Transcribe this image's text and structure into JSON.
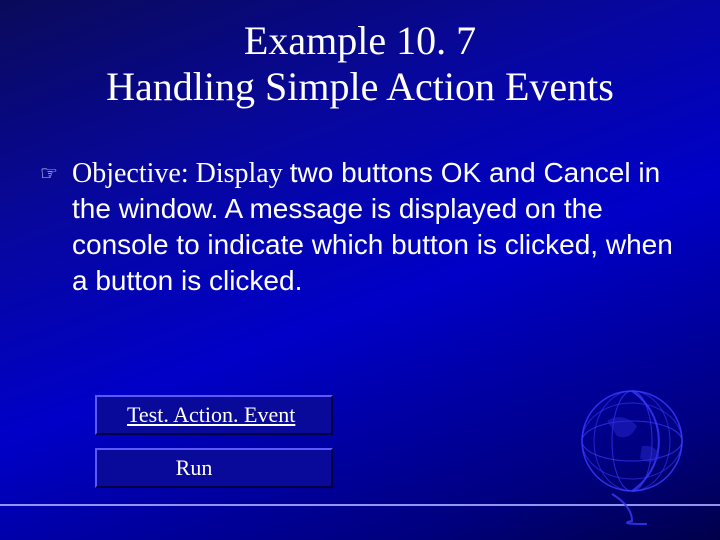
{
  "title_line1": "Example 10. 7",
  "title_line2": "Handling Simple Action Events",
  "bullet": {
    "label": "Objective: Display ",
    "body": "two buttons OK and Cancel in the window. A message is displayed on the console to indicate which button is clicked, when a button is clicked."
  },
  "links": {
    "test": "Test. Action. Event",
    "run": "Run"
  }
}
